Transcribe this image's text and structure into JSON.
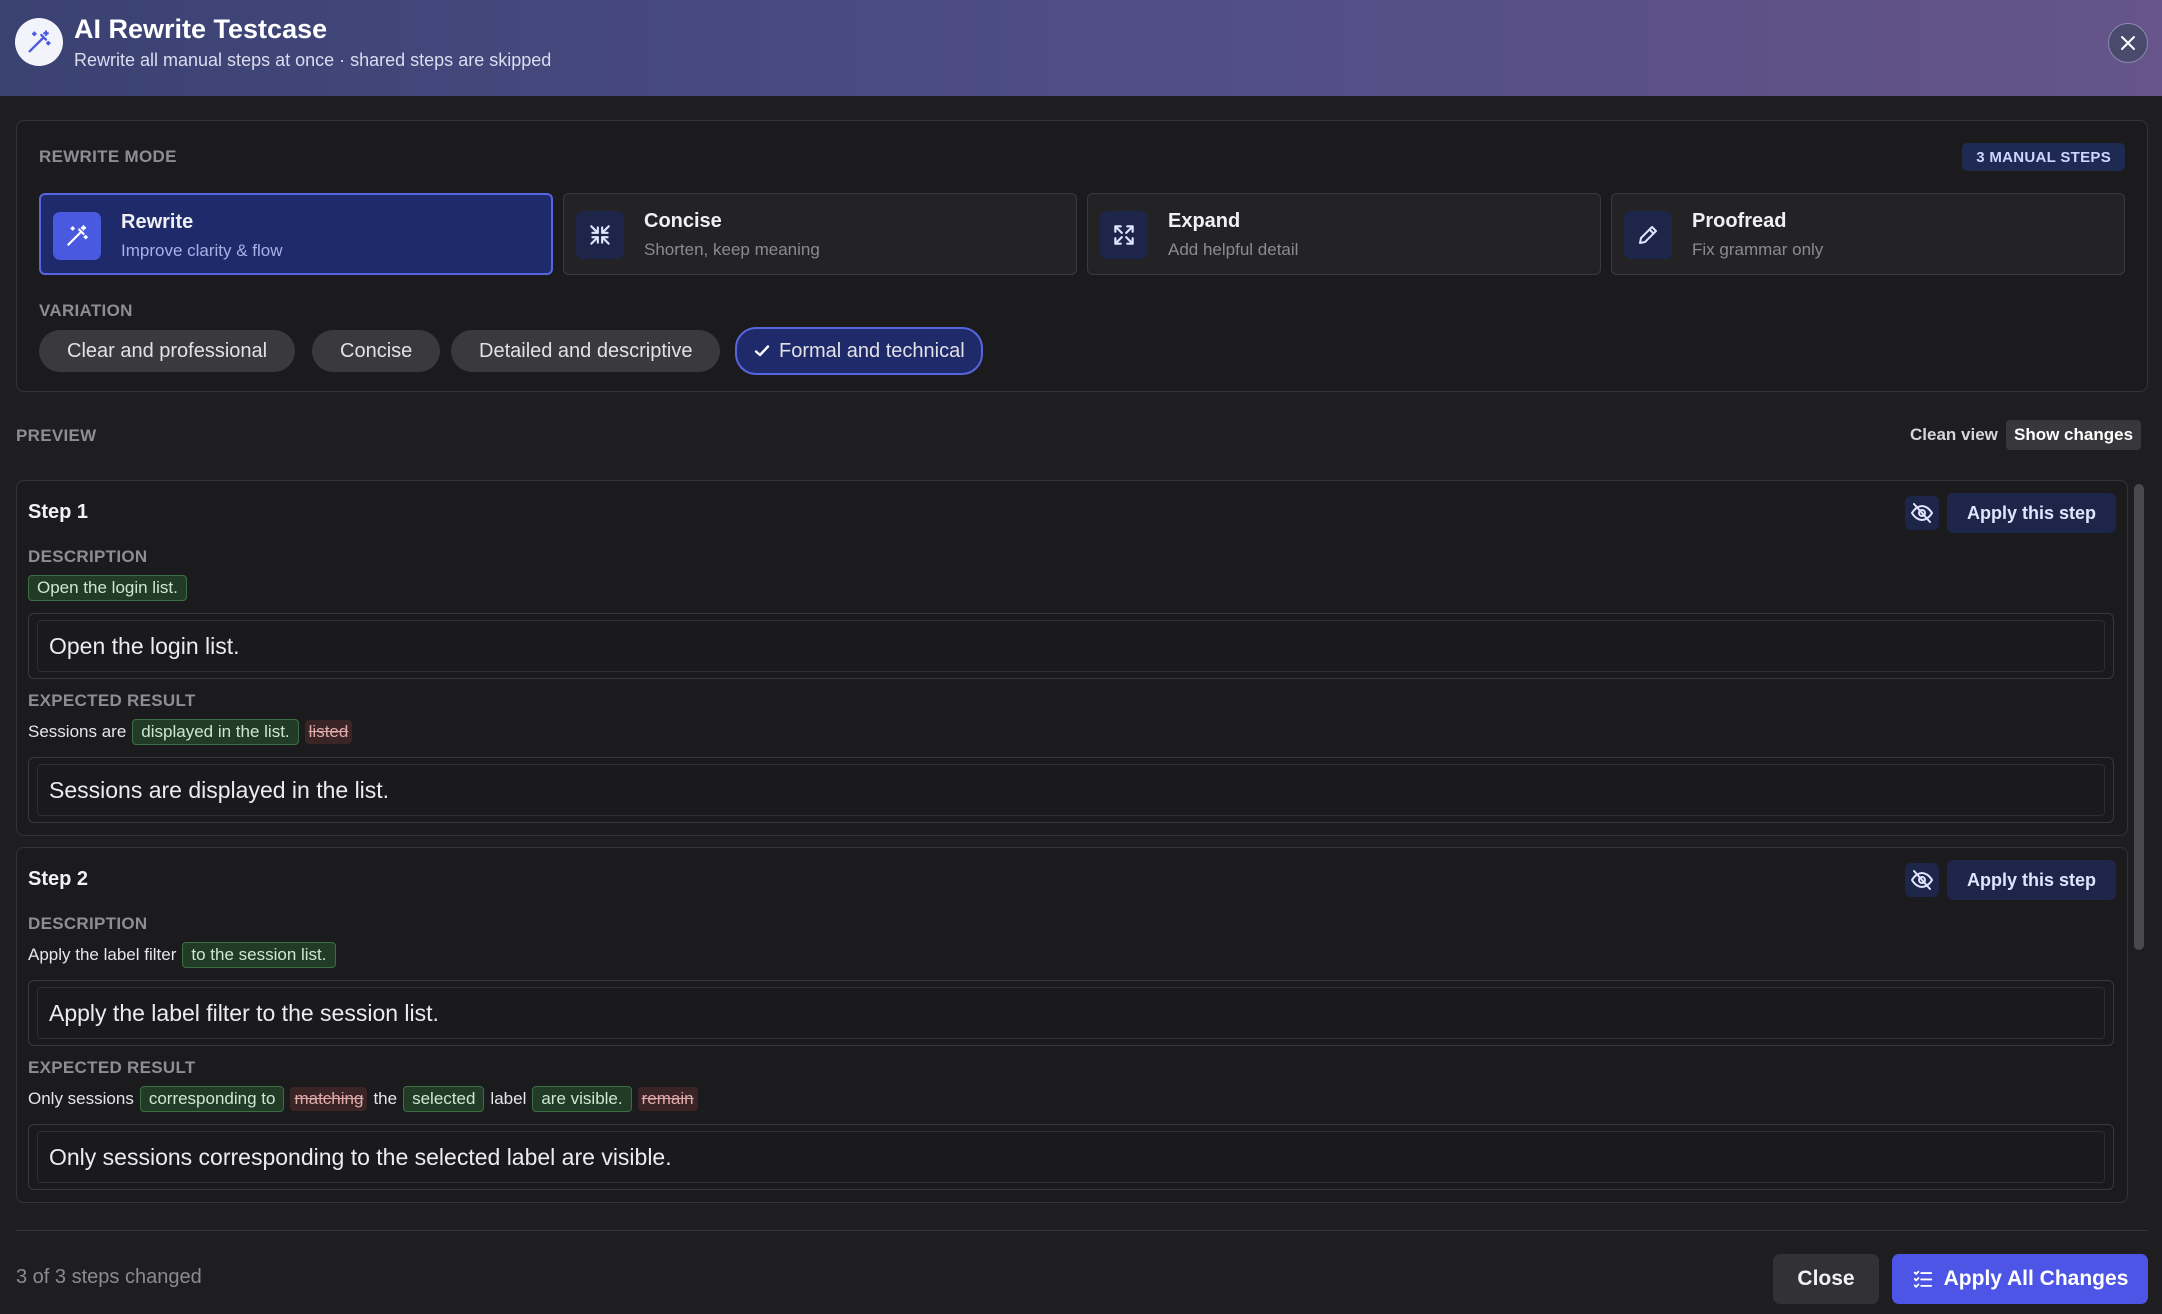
{
  "header": {
    "title": "AI Rewrite Testcase",
    "subtitle": "Rewrite all manual steps at once · shared steps are skipped",
    "logo_icon": "magic-wand-icon",
    "close_icon": "close-icon"
  },
  "mode": {
    "label": "REWRITE MODE",
    "badge": "3 MANUAL STEPS",
    "cards": [
      {
        "title": "Rewrite",
        "desc": "Improve clarity & flow",
        "icon": "magic-wand-icon",
        "active": true
      },
      {
        "title": "Concise",
        "desc": "Shorten, keep meaning",
        "icon": "minimize-arrows-icon",
        "active": false
      },
      {
        "title": "Expand",
        "desc": "Add helpful detail",
        "icon": "maximize-arrows-icon",
        "active": false
      },
      {
        "title": "Proofread",
        "desc": "Fix grammar only",
        "icon": "pencil-icon",
        "active": false
      }
    ]
  },
  "variation": {
    "label": "VARIATION",
    "chips": [
      {
        "label": "Clear and professional",
        "selected": false
      },
      {
        "label": "Concise",
        "selected": false
      },
      {
        "label": "Detailed and descriptive",
        "selected": false
      },
      {
        "label": "Formal and technical",
        "selected": true
      }
    ]
  },
  "preview": {
    "label": "PREVIEW",
    "clean_view": "Clean view",
    "show_changes": "Show changes"
  },
  "steps": [
    {
      "title": "Step 1",
      "apply_label": "Apply this step",
      "description_label": "DESCRIPTION",
      "description_diff": [
        {
          "type": "ins",
          "text": "Open the login list."
        }
      ],
      "description_text": "Open the login list.",
      "expected_label": "EXPECTED RESULT",
      "expected_diff": [
        {
          "type": "same",
          "text": "Sessions are"
        },
        {
          "type": "ins",
          "text": "displayed in the list."
        },
        {
          "type": "del",
          "text": "listed"
        }
      ],
      "expected_text": "Sessions are displayed in the list."
    },
    {
      "title": "Step 2",
      "apply_label": "Apply this step",
      "description_label": "DESCRIPTION",
      "description_diff": [
        {
          "type": "same",
          "text": "Apply the label filter"
        },
        {
          "type": "ins",
          "text": "to the session list."
        }
      ],
      "description_text": "Apply the label filter to the session list.",
      "expected_label": "EXPECTED RESULT",
      "expected_diff": [
        {
          "type": "same",
          "text": "Only sessions"
        },
        {
          "type": "ins",
          "text": "corresponding to"
        },
        {
          "type": "del",
          "text": "matching"
        },
        {
          "type": "same",
          "text": "the"
        },
        {
          "type": "ins",
          "text": "selected"
        },
        {
          "type": "same",
          "text": "label"
        },
        {
          "type": "ins",
          "text": "are visible."
        },
        {
          "type": "del",
          "text": "remain"
        }
      ],
      "expected_text": "Only sessions corresponding to the selected label are visible."
    }
  ],
  "footer": {
    "status": "3 of 3 steps changed",
    "close_label": "Close",
    "apply_all_label": "Apply All Changes",
    "apply_all_icon": "list-check-icon"
  },
  "colors": {
    "accent": "#4d55e6",
    "active_card": "#1f2a6b",
    "insert_bg": "#213b27",
    "delete_bg": "#3a2425"
  }
}
